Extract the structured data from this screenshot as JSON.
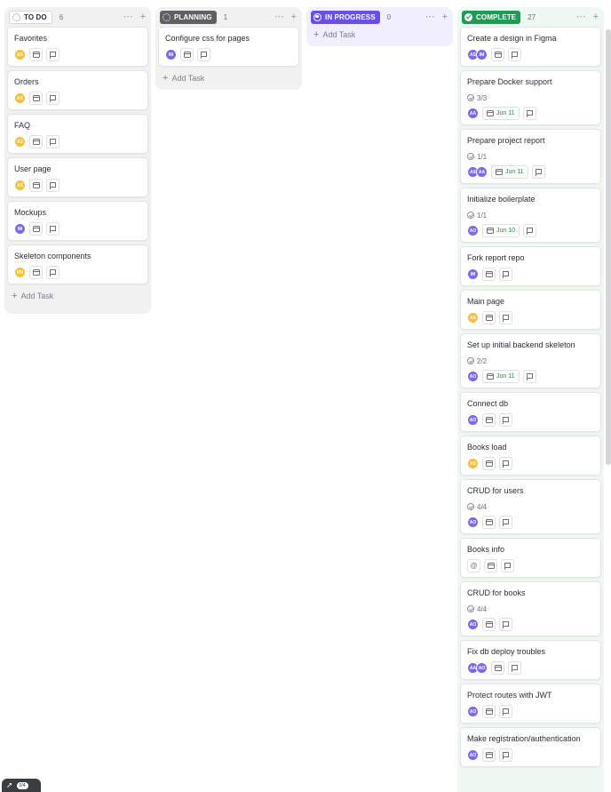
{
  "columns": [
    {
      "id": "todo",
      "status": "TO DO",
      "count": "6",
      "add_label": "Add Task",
      "cards": [
        {
          "title": "Favorites",
          "avatars": [
            {
              "initials": "AS",
              "color": "#f6be3c"
            }
          ]
        },
        {
          "title": "Orders",
          "avatars": [
            {
              "initials": "AS",
              "color": "#f6be3c"
            }
          ]
        },
        {
          "title": "FAQ",
          "avatars": [
            {
              "initials": "AS",
              "color": "#f6be3c"
            }
          ]
        },
        {
          "title": "User page",
          "avatars": [
            {
              "initials": "AS",
              "color": "#f6be3c"
            }
          ]
        },
        {
          "title": "Mockups",
          "avatars": [
            {
              "initials": "IM",
              "color": "#7b68ee"
            }
          ]
        },
        {
          "title": "Skeleton components",
          "avatars": [
            {
              "initials": "RN",
              "color": "#f6be3c"
            }
          ]
        }
      ]
    },
    {
      "id": "planning",
      "status": "PLANNING",
      "count": "1",
      "add_label": "Add Task",
      "cards": [
        {
          "title": "Configure css for pages",
          "avatars": [
            {
              "initials": "IM",
              "color": "#7b68ee"
            }
          ]
        }
      ]
    },
    {
      "id": "inprogress",
      "status": "IN PROGRESS",
      "count": "0",
      "add_label": "Add Task",
      "cards": []
    },
    {
      "id": "complete",
      "status": "COMPLETE",
      "count": "27",
      "cards": [
        {
          "title": "Create a design in Figma",
          "avatars": [
            {
              "initials": "AS",
              "color": "#7b68ee"
            },
            {
              "initials": "IM",
              "color": "#7b68ee"
            }
          ]
        },
        {
          "title": "Prepare Docker support",
          "subtasks": "3/3",
          "date": "Jun 11",
          "avatars": [
            {
              "initials": "AA",
              "color": "#7b68ee"
            }
          ]
        },
        {
          "title": "Prepare project report",
          "subtasks": "1/1",
          "date": "Jun 11",
          "avatars": [
            {
              "initials": "AS",
              "color": "#7b68ee"
            },
            {
              "initials": "AA",
              "color": "#7b68ee"
            }
          ]
        },
        {
          "title": "Initialize boilerplate",
          "subtasks": "1/1",
          "date": "Jun 10",
          "avatars": [
            {
              "initials": "AO",
              "color": "#7b68ee"
            }
          ]
        },
        {
          "title": "Fork report repo",
          "avatars": [
            {
              "initials": "IM",
              "color": "#7b68ee"
            }
          ]
        },
        {
          "title": "Main page",
          "avatars": [
            {
              "initials": "AS",
              "color": "#f6be3c"
            }
          ]
        },
        {
          "title": "Set up initial backend skeleton",
          "subtasks": "2/2",
          "date": "Jun 11",
          "avatars": [
            {
              "initials": "AO",
              "color": "#7b68ee"
            }
          ]
        },
        {
          "title": "Connect db",
          "avatars": [
            {
              "initials": "AO",
              "color": "#7b68ee"
            }
          ]
        },
        {
          "title": "Books load",
          "avatars": [
            {
              "initials": "AS",
              "color": "#f6be3c"
            }
          ]
        },
        {
          "title": "CRUD for users",
          "subtasks": "4/4",
          "avatars": [
            {
              "initials": "AO",
              "color": "#7b68ee"
            }
          ]
        },
        {
          "title": "Books info",
          "unassigned": true,
          "avatars": []
        },
        {
          "title": "CRUD for books",
          "subtasks": "4/4",
          "avatars": [
            {
              "initials": "AO",
              "color": "#7b68ee"
            }
          ]
        },
        {
          "title": "Fix db deploy troubles",
          "avatars": [
            {
              "initials": "AA",
              "color": "#7b68ee"
            },
            {
              "initials": "AO",
              "color": "#7b68ee"
            }
          ]
        },
        {
          "title": "Protect routes with JWT",
          "avatars": [
            {
              "initials": "AO",
              "color": "#7b68ee"
            }
          ]
        },
        {
          "title": "Make registration/authentication",
          "avatars": [
            {
              "initials": "AO",
              "color": "#7b68ee"
            }
          ]
        }
      ]
    }
  ],
  "footer": {
    "progress": "0/4"
  }
}
